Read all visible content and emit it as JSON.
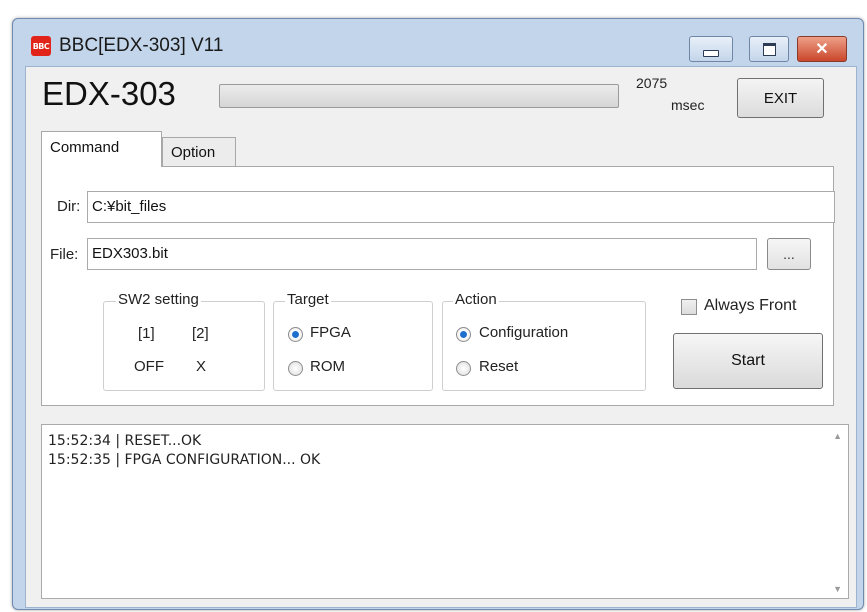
{
  "window": {
    "app_icon_text": "BBC",
    "title": "BBC[EDX-303] V11"
  },
  "header": {
    "device_name": "EDX-303",
    "progress": 0,
    "elapsed_value": "2075",
    "elapsed_unit": "msec",
    "exit_label": "EXIT"
  },
  "tabs": [
    {
      "label": "Command",
      "active": true
    },
    {
      "label": "Option",
      "active": false
    }
  ],
  "command": {
    "dir_label": "Dir:",
    "dir_value": "C:¥bit_files",
    "file_label": "File:",
    "file_value": "EDX303.bit",
    "browse_label": "...",
    "sw2": {
      "title": "SW2 setting",
      "headers": [
        "[1]",
        "[2]"
      ],
      "values": [
        "OFF",
        "X"
      ]
    },
    "target": {
      "title": "Target",
      "options": [
        {
          "label": "FPGA",
          "checked": true
        },
        {
          "label": "ROM",
          "checked": false
        }
      ]
    },
    "action": {
      "title": "Action",
      "options": [
        {
          "label": "Configuration",
          "checked": true
        },
        {
          "label": "Reset",
          "checked": false
        }
      ]
    },
    "always_front_label": "Always Front",
    "always_front_checked": false,
    "start_label": "Start"
  },
  "log": {
    "lines": [
      "15:52:34 | RESET...OK",
      "15:52:35 | FPGA CONFIGURATION... OK"
    ]
  }
}
